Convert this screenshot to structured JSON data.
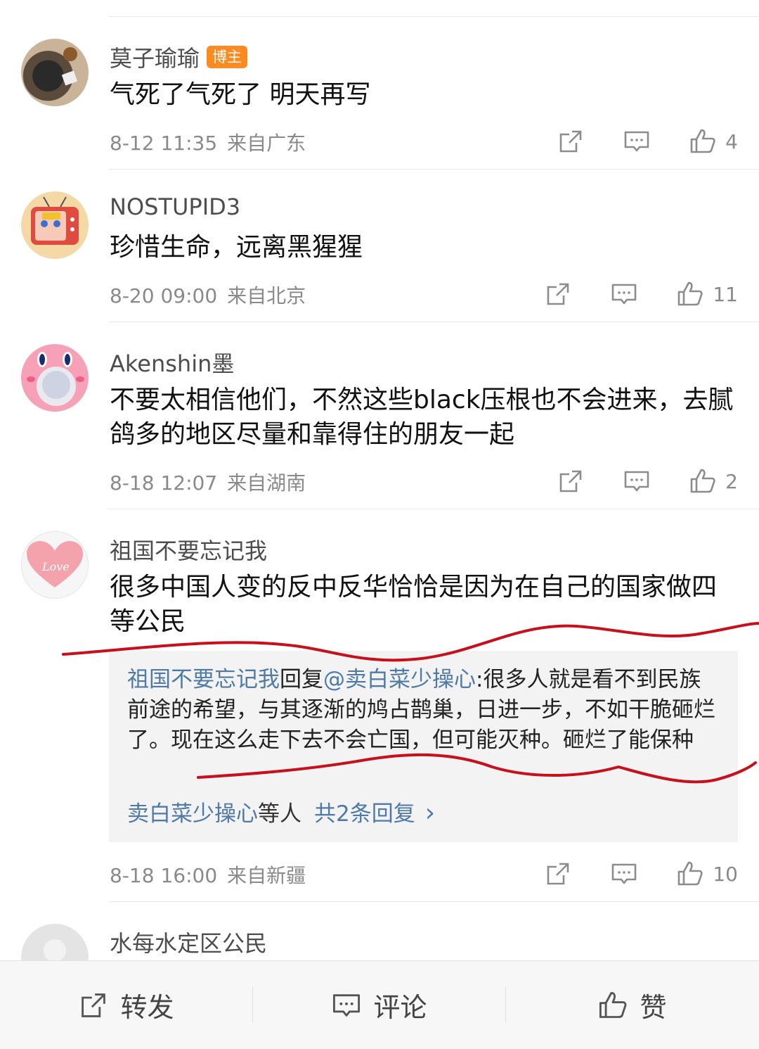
{
  "comments": [
    {
      "username": "莫子瑜瑜",
      "badge": "博主",
      "text": "气死了气死了 明天再写",
      "time": "8-12 11:35",
      "location": "来自广东",
      "likes": "4"
    },
    {
      "username": "NOSTUPID3",
      "text": "珍惜生命，远离黑猩猩",
      "time": "8-20 09:00",
      "location": "来自北京",
      "likes": "11"
    },
    {
      "username": "Akenshin墨",
      "text": "不要太相信他们，不然这些black压根也不会进来，去腻鸽多的地区尽量和靠得住的朋友一起",
      "time": "8-18 12:07",
      "location": "来自湖南",
      "likes": "2"
    },
    {
      "username": "祖国不要忘记我",
      "text": "很多中国人变的反中反华恰恰是因为在自己的国家做四等公民",
      "reply": {
        "author": "祖国不要忘记我",
        "verb": "回复",
        "target": "@卖白菜少操心",
        "text": ":很多人就是看不到民族前途的希望，与其逐渐的鸠占鹊巢，日进一步，不如干脆砸烂了。现在这么走下去不会亡国，但可能灭种。砸烂了能保种",
        "more_user": "卖白菜少操心",
        "more_suffix": "等人",
        "more_count": "共2条回复",
        "more_arrow": "›"
      },
      "time": "8-18 16:00",
      "location": "来自新疆",
      "likes": "10"
    },
    {
      "username": "水每水定区公民"
    }
  ],
  "bottom_bar": {
    "repost": "转发",
    "comment": "评论",
    "like": "赞"
  },
  "colors": {
    "link": "#4f7aa8",
    "badge": "#ff8a1f",
    "annotation": "#c8101c"
  },
  "icons": [
    "share-icon",
    "comment-icon",
    "like-icon"
  ]
}
